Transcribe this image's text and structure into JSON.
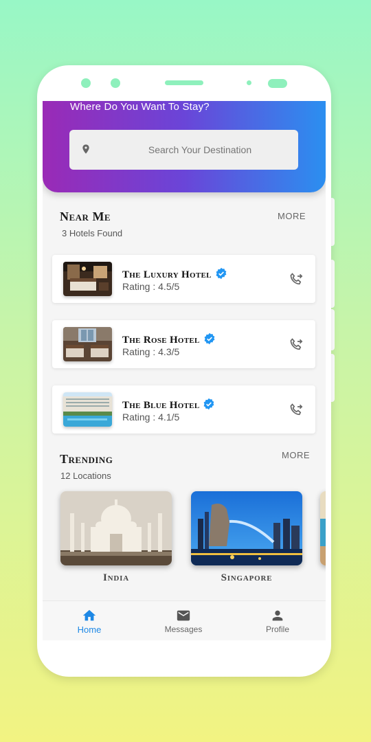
{
  "header": {
    "title": "Where Do You Want To Stay?"
  },
  "search": {
    "placeholder": "Search Your Destination",
    "icon": "location-pin-icon"
  },
  "near_me": {
    "title": "Near Me",
    "subtitle": "3 Hotels Found",
    "more_label": "MORE",
    "hotels": [
      {
        "name": "The Luxury Hotel",
        "rating": "Rating : 4.5/5"
      },
      {
        "name": "The Rose Hotel",
        "rating": "Rating : 4.3/5"
      },
      {
        "name": "The Blue Hotel",
        "rating": "Rating : 4.1/5"
      }
    ]
  },
  "trending": {
    "title": "Trending",
    "subtitle": "12 Locations",
    "more_label": "MORE",
    "locations": [
      {
        "name": "India"
      },
      {
        "name": "Singapore"
      }
    ]
  },
  "nav": {
    "items": [
      {
        "label": "Home",
        "icon": "home-icon"
      },
      {
        "label": "Messages",
        "icon": "mail-icon"
      },
      {
        "label": "Profile",
        "icon": "person-icon"
      }
    ]
  },
  "colors": {
    "accent": "#1e88e5",
    "gradient_start": "#9a2ab6",
    "gradient_end": "#2b8ff0",
    "verified": "#2196f3"
  }
}
